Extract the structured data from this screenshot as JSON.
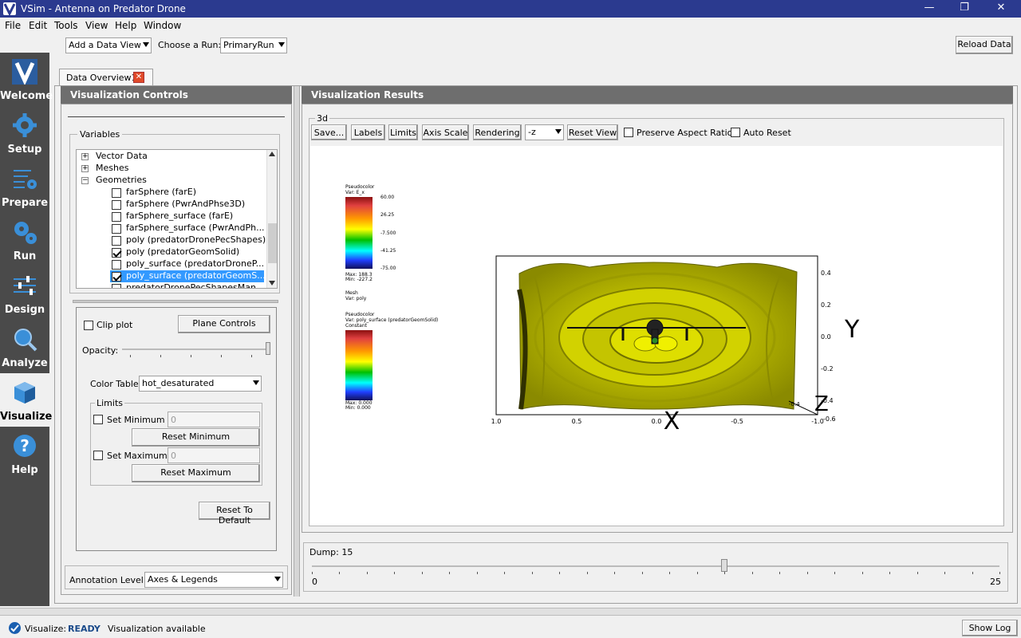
{
  "window": {
    "title": "VSim - Antenna on Predator Drone",
    "minimize": "—",
    "restore": "❐",
    "close": "✕"
  },
  "menu": [
    "File",
    "Edit",
    "Tools",
    "View",
    "Help",
    "Window"
  ],
  "toolbar": {
    "add_data_view": "Add a Data View",
    "choose_run_label": "Choose a Run:",
    "run_value": "PrimaryRun",
    "reload": "Reload Data"
  },
  "sidebar": [
    {
      "label": "Welcome",
      "icon": "vsim-logo-icon"
    },
    {
      "label": "Setup",
      "icon": "gear-icon"
    },
    {
      "label": "Prepare",
      "icon": "list-gear-icon"
    },
    {
      "label": "Run",
      "icon": "gears-icon"
    },
    {
      "label": "Design",
      "icon": "sliders-icon"
    },
    {
      "label": "Analyze",
      "icon": "magnifier-icon"
    },
    {
      "label": "Visualize",
      "icon": "cube-icon"
    },
    {
      "label": "Help",
      "icon": "question-icon"
    }
  ],
  "tab": {
    "label": "Data Overview1"
  },
  "controls": {
    "header": "Visualization Controls",
    "variables_label": "Variables",
    "tree": [
      {
        "label": "Vector Data",
        "type": "group",
        "expanded": false
      },
      {
        "label": "Meshes",
        "type": "group",
        "expanded": false
      },
      {
        "label": "Geometries",
        "type": "group",
        "expanded": true
      },
      {
        "label": "farSphere (farE)",
        "checked": false
      },
      {
        "label": "farSphere (PwrAndPhse3D)",
        "checked": false
      },
      {
        "label": "farSphere_surface (farE)",
        "checked": false
      },
      {
        "label": "farSphere_surface (PwrAndPh...",
        "checked": false
      },
      {
        "label": "poly (predatorDronePecShapes)",
        "checked": false
      },
      {
        "label": "poly (predatorGeomSolid)",
        "checked": true
      },
      {
        "label": "poly_surface (predatorDroneP...",
        "checked": false
      },
      {
        "label": "poly_surface (predatorGeomS...",
        "checked": true,
        "selected": true
      },
      {
        "label": "predatorDronePecShapesMan",
        "checked": false
      }
    ],
    "clip_plot": "Clip plot",
    "plane_controls": "Plane Controls",
    "opacity": "Opacity:",
    "color_table_label": "Color Table",
    "color_table_value": "hot_desaturated",
    "limits": "Limits",
    "set_minimum": "Set Minimum",
    "min_value": "0",
    "reset_minimum": "Reset Minimum",
    "set_maximum": "Set Maximum",
    "max_value": "0",
    "reset_maximum": "Reset Maximum",
    "reset_default": "Reset To Default",
    "annotation_label": "Annotation Level:",
    "annotation_value": "Axes & Legends"
  },
  "results": {
    "header": "Visualization Results",
    "group": "3d",
    "buttons": {
      "save": "Save...",
      "labels": "Labels",
      "limits": "Limits",
      "axis_scale": "Axis Scale",
      "rendering": "Rendering",
      "view": "-z",
      "reset_view": "Reset View"
    },
    "preserve_aspect": "Preserve Aspect Ratio",
    "auto_reset": "Auto Reset",
    "legend1": {
      "title": "Pseudocolor",
      "var": "Var: E_x",
      "ticks": [
        "60.00",
        "26.25",
        "-7.500",
        "-41.25",
        "-75.00"
      ],
      "max": "Max: 188.3",
      "min": "Min: -227.2"
    },
    "legend_mesh": {
      "title": "Mesh",
      "var": "Var: poly"
    },
    "legend2": {
      "title": "Pseudocolor",
      "var": "Var: poly_surface (predatorGeomSolid)",
      "constant": "Constant",
      "max": "Max: 0.000",
      "min": "Min: 0.000"
    },
    "x_ticks": [
      "1.0",
      "0.5",
      "0.0",
      "-0.5",
      "-1.0"
    ],
    "y_ticks": [
      "0.4",
      "0.2",
      "0.0",
      "-0.2",
      "-0.4"
    ],
    "x_label": "X",
    "y_label": "Y",
    "z_label": "Z",
    "z_ticks": [
      "-0.6",
      "-0.4"
    ],
    "dump_label": "Dump: 15",
    "dump_min": "0",
    "dump_max": "25",
    "dump_value": 15
  },
  "status": {
    "label": "Visualize:",
    "state": "READY",
    "message": "Visualization available",
    "show_log": "Show Log"
  },
  "colors": {
    "titlebar": "#2b3a8f",
    "sidebar": "#4a4a4a",
    "panel_header": "#6e6e6e",
    "selected": "#3399ff",
    "ready": "#1a4a8a",
    "surface": "#c8c800"
  }
}
